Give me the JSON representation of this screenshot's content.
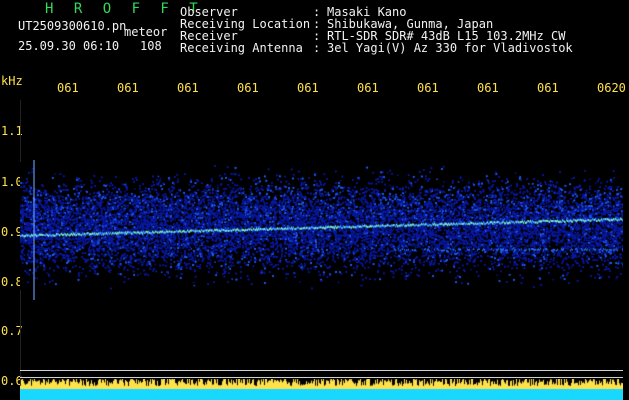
{
  "header": {
    "title": "H R O F F T",
    "filename": "UT2509300610.pn",
    "mode": "meteor",
    "datetime": "25.09.30 06:10",
    "count": "108"
  },
  "info": [
    {
      "key": "Observer",
      "value": "Masaki Kano"
    },
    {
      "key": "Receiving Location",
      "value": "Shibukawa, Gunma, Japan"
    },
    {
      "key": "Receiver",
      "value": "RTL-SDR SDR# 43dB L15 103.2MHz CW"
    },
    {
      "key": "Receiving Antenna",
      "value": "3el Yagi(V) Az 330 for Vladivostok"
    }
  ],
  "separator": ":",
  "axis": {
    "unit": "kHz",
    "y_ticks": [
      "1.1",
      "1.0",
      "0.9",
      "0.8",
      "0.7",
      "0.6"
    ],
    "x_ticks": [
      "061",
      "061",
      "061",
      "061",
      "061",
      "061",
      "061",
      "061",
      "061",
      "0620"
    ]
  },
  "colors": {
    "title": "#34d85a",
    "text": "#f2f2f2",
    "axis": "#ffe14a",
    "spectrogram_dark": "#0a1aa0",
    "spectrogram_mid": "#2060ff",
    "signal": "#7ef0c0",
    "power_bar": "#ffe14a",
    "power_base": "#19d8ff"
  }
}
